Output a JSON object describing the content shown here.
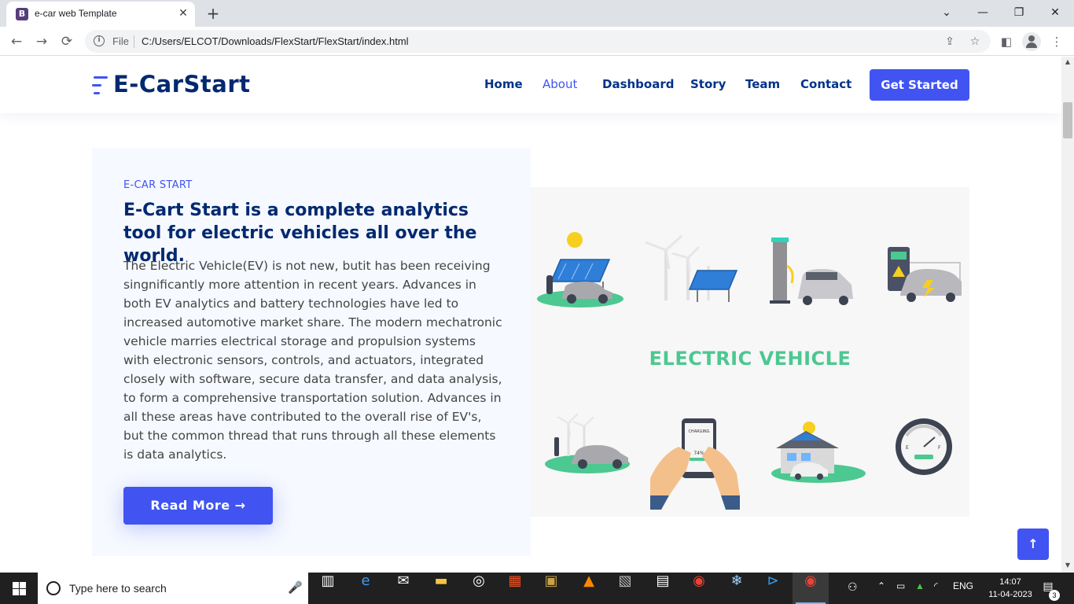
{
  "browser": {
    "tab_favicon": "B",
    "tab_title": "e-car web Template",
    "tab_close": "✕",
    "new_tab": "+",
    "window_controls": {
      "chevron": "⌄",
      "minimize": "—",
      "restore": "❐",
      "close": "✕"
    },
    "nav": {
      "back": "←",
      "forward": "→",
      "reload": "⟳"
    },
    "address_scheme_label": "File",
    "address_url": "C:/Users/ELCOT/Downloads/FlexStart/FlexStart/index.html",
    "icons": {
      "info": "i",
      "share": "⇪",
      "bookmark": "☆",
      "sidebar": "◧",
      "menu": "⋮"
    }
  },
  "site": {
    "logo_text": "E-CarStart",
    "nav_items": [
      "Home",
      "About",
      "Dashboard",
      "Story",
      "Team",
      "Contact"
    ],
    "active_nav": "About",
    "cta_label": "Get Started"
  },
  "about": {
    "eyebrow": "E-CAR START",
    "headline": "E-Cart Start is a complete analytics tool for electric vehicles all over the world.",
    "body": "The Electric Vehicle(EV) is not new, butit has been receiving singnificantly more attention in recent years. Advances in both EV analytics and battery technologies have led to increased automotive market share. The modern mechatronic vehicle marries electrical storage and propulsion systems with electronic sensors, controls, and actuators, integrated closely with software, secure data transfer, and data analysis, to form a comprehensive transportation solution. Advances in all these areas have contributed to the overall rise of EV's, but the common thread that runs through all these elements is data analytics.",
    "read_more": "Read More",
    "read_more_arrow": "→"
  },
  "illustration": {
    "title": "ELECTRIC VEHICLE",
    "phone_screen_label": "CHARGING",
    "phone_percent": "74%",
    "gauge_empty": "E",
    "gauge_full": "F",
    "colors": {
      "green": "#4cc891",
      "solar_blue": "#2f7fd8",
      "sun": "#f7cf1e",
      "car": "#a9a9ad",
      "dark": "#3d4351"
    }
  },
  "back_to_top": "↑",
  "scrollbar": {
    "up": "▲",
    "down": "▼"
  },
  "taskbar": {
    "search_placeholder": "Type here to search",
    "mic": "🎤",
    "apps": [
      "task-view",
      "edge",
      "mail",
      "file-explorer",
      "media",
      "store",
      "app-dark",
      "vlc",
      "photo",
      "calculator",
      "chrome",
      "snipping",
      "vscode",
      "chrome-active"
    ],
    "tray_lang": "ENG",
    "time": "14:07",
    "date": "11-04-2023",
    "notification_count": "3"
  },
  "colors": {
    "accent": "#4154f1",
    "navy": "#012970",
    "about_bg": "#f6f9ff"
  }
}
